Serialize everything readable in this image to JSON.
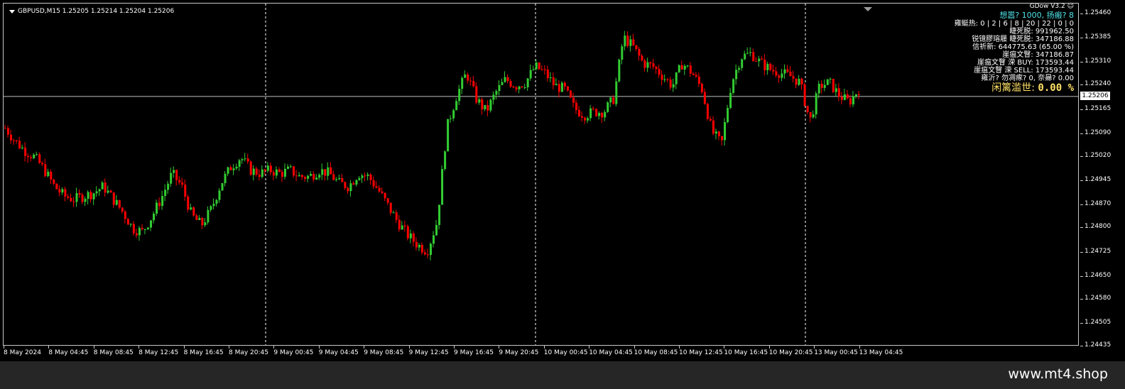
{
  "chart": {
    "symbol_text": "GBPUSD,M15  1.25205 1.25214 1.25204 1.25206",
    "current_price_label": "1.25206",
    "colors": {
      "bull": "#32cd32",
      "bear": "#ff0000",
      "grid": "#ffffff",
      "price_line": "#c0c0c0",
      "background": "#000000"
    }
  },
  "indicator": {
    "name": "GDow V3.2",
    "name_icon": "smiley-icon",
    "line1": "想嚣? 1000, 扬瘢? 8",
    "line2": "雍蜓热: 0 | 2 | 6 | 8 | 20 | 22 | 0 | 0",
    "line3": "睫死脱: 991962.50",
    "line4": "锐镱膠瑢屦    睫死脱: 347186.88",
    "line5": "信祈新: 644775.63 (65.00 %)",
    "line6": "崖瘟文瞖: 347186.87",
    "line7": "崖瘟文瞖 溁    BUY: 173593.44",
    "line8": "崖瘟文瞖 溁    SELL: 173593.44",
    "line9": "雍沂? 勿凋瘃? 0, 奈曏? 0.00",
    "line10_label": "闲篱滥世: ",
    "line10_value": "0.00 %"
  },
  "y_axis": {
    "labels": [
      "1.25460",
      "1.25385",
      "1.25310",
      "1.25240",
      "1.25165",
      "1.25090",
      "1.25020",
      "1.24945",
      "1.24870",
      "1.24800",
      "1.24725",
      "1.24650",
      "1.24580",
      "1.24505",
      "1.24435"
    ]
  },
  "x_axis": {
    "labels": [
      "8 May 2024",
      "8 May 04:45",
      "8 May 08:45",
      "8 May 12:45",
      "8 May 16:45",
      "8 May 20:45",
      "9 May 00:45",
      "9 May 04:45",
      "9 May 08:45",
      "9 May 12:45",
      "9 May 16:45",
      "9 May 20:45",
      "10 May 00:45",
      "10 May 04:45",
      "10 May 08:45",
      "10 May 12:45",
      "10 May 16:45",
      "10 May 20:45",
      "13 May 00:45",
      "13 May 04:45"
    ]
  },
  "footer": {
    "watermark": "www.mt4.shop"
  },
  "chart_data": {
    "type": "candlestick",
    "symbol": "GBPUSD",
    "timeframe": "M15",
    "ylim": [
      1.24435,
      1.25475
    ],
    "current_price": 1.25206,
    "x_ticks": [
      "8 May 2024",
      "8 May 04:45",
      "8 May 08:45",
      "8 May 12:45",
      "8 May 16:45",
      "8 May 20:45",
      "9 May 00:45",
      "9 May 04:45",
      "9 May 08:45",
      "9 May 12:45",
      "9 May 16:45",
      "9 May 20:45",
      "10 May 00:45",
      "10 May 04:45",
      "10 May 08:45",
      "10 May 12:45",
      "10 May 16:45",
      "10 May 20:45",
      "13 May 00:45",
      "13 May 04:45"
    ],
    "close_path": [
      1.251,
      1.2506,
      1.2503,
      1.2501,
      1.2497,
      1.2492,
      1.2489,
      1.2488,
      1.2489,
      1.249,
      1.2492,
      1.2488,
      1.2484,
      1.2479,
      1.2478,
      1.2483,
      1.2489,
      1.2496,
      1.2492,
      1.2483,
      1.248,
      1.2485,
      1.2493,
      1.2498,
      1.2501,
      1.2497,
      1.2496,
      1.2497,
      1.2496,
      1.2497,
      1.2495,
      1.2495,
      1.2497,
      1.2496,
      1.2493,
      1.2492,
      1.2496,
      1.2495,
      1.2491,
      1.2486,
      1.2481,
      1.2477,
      1.2474,
      1.2472,
      1.2481,
      1.251,
      1.252,
      1.2527,
      1.2519,
      1.2515,
      1.2521,
      1.2525,
      1.2523,
      1.2524,
      1.2529,
      1.2527,
      1.2523,
      1.2522,
      1.2516,
      1.2514,
      1.2515,
      1.2515,
      1.2519,
      1.2538,
      1.2535,
      1.253,
      1.2529,
      1.2526,
      1.2523,
      1.253,
      1.2527,
      1.2522,
      1.2509,
      1.2505,
      1.2524,
      1.2532,
      1.2533,
      1.253,
      1.2528,
      1.2527,
      1.2526,
      1.2524,
      1.2512,
      1.2523,
      1.2524,
      1.252,
      1.2518,
      1.2522
    ]
  }
}
